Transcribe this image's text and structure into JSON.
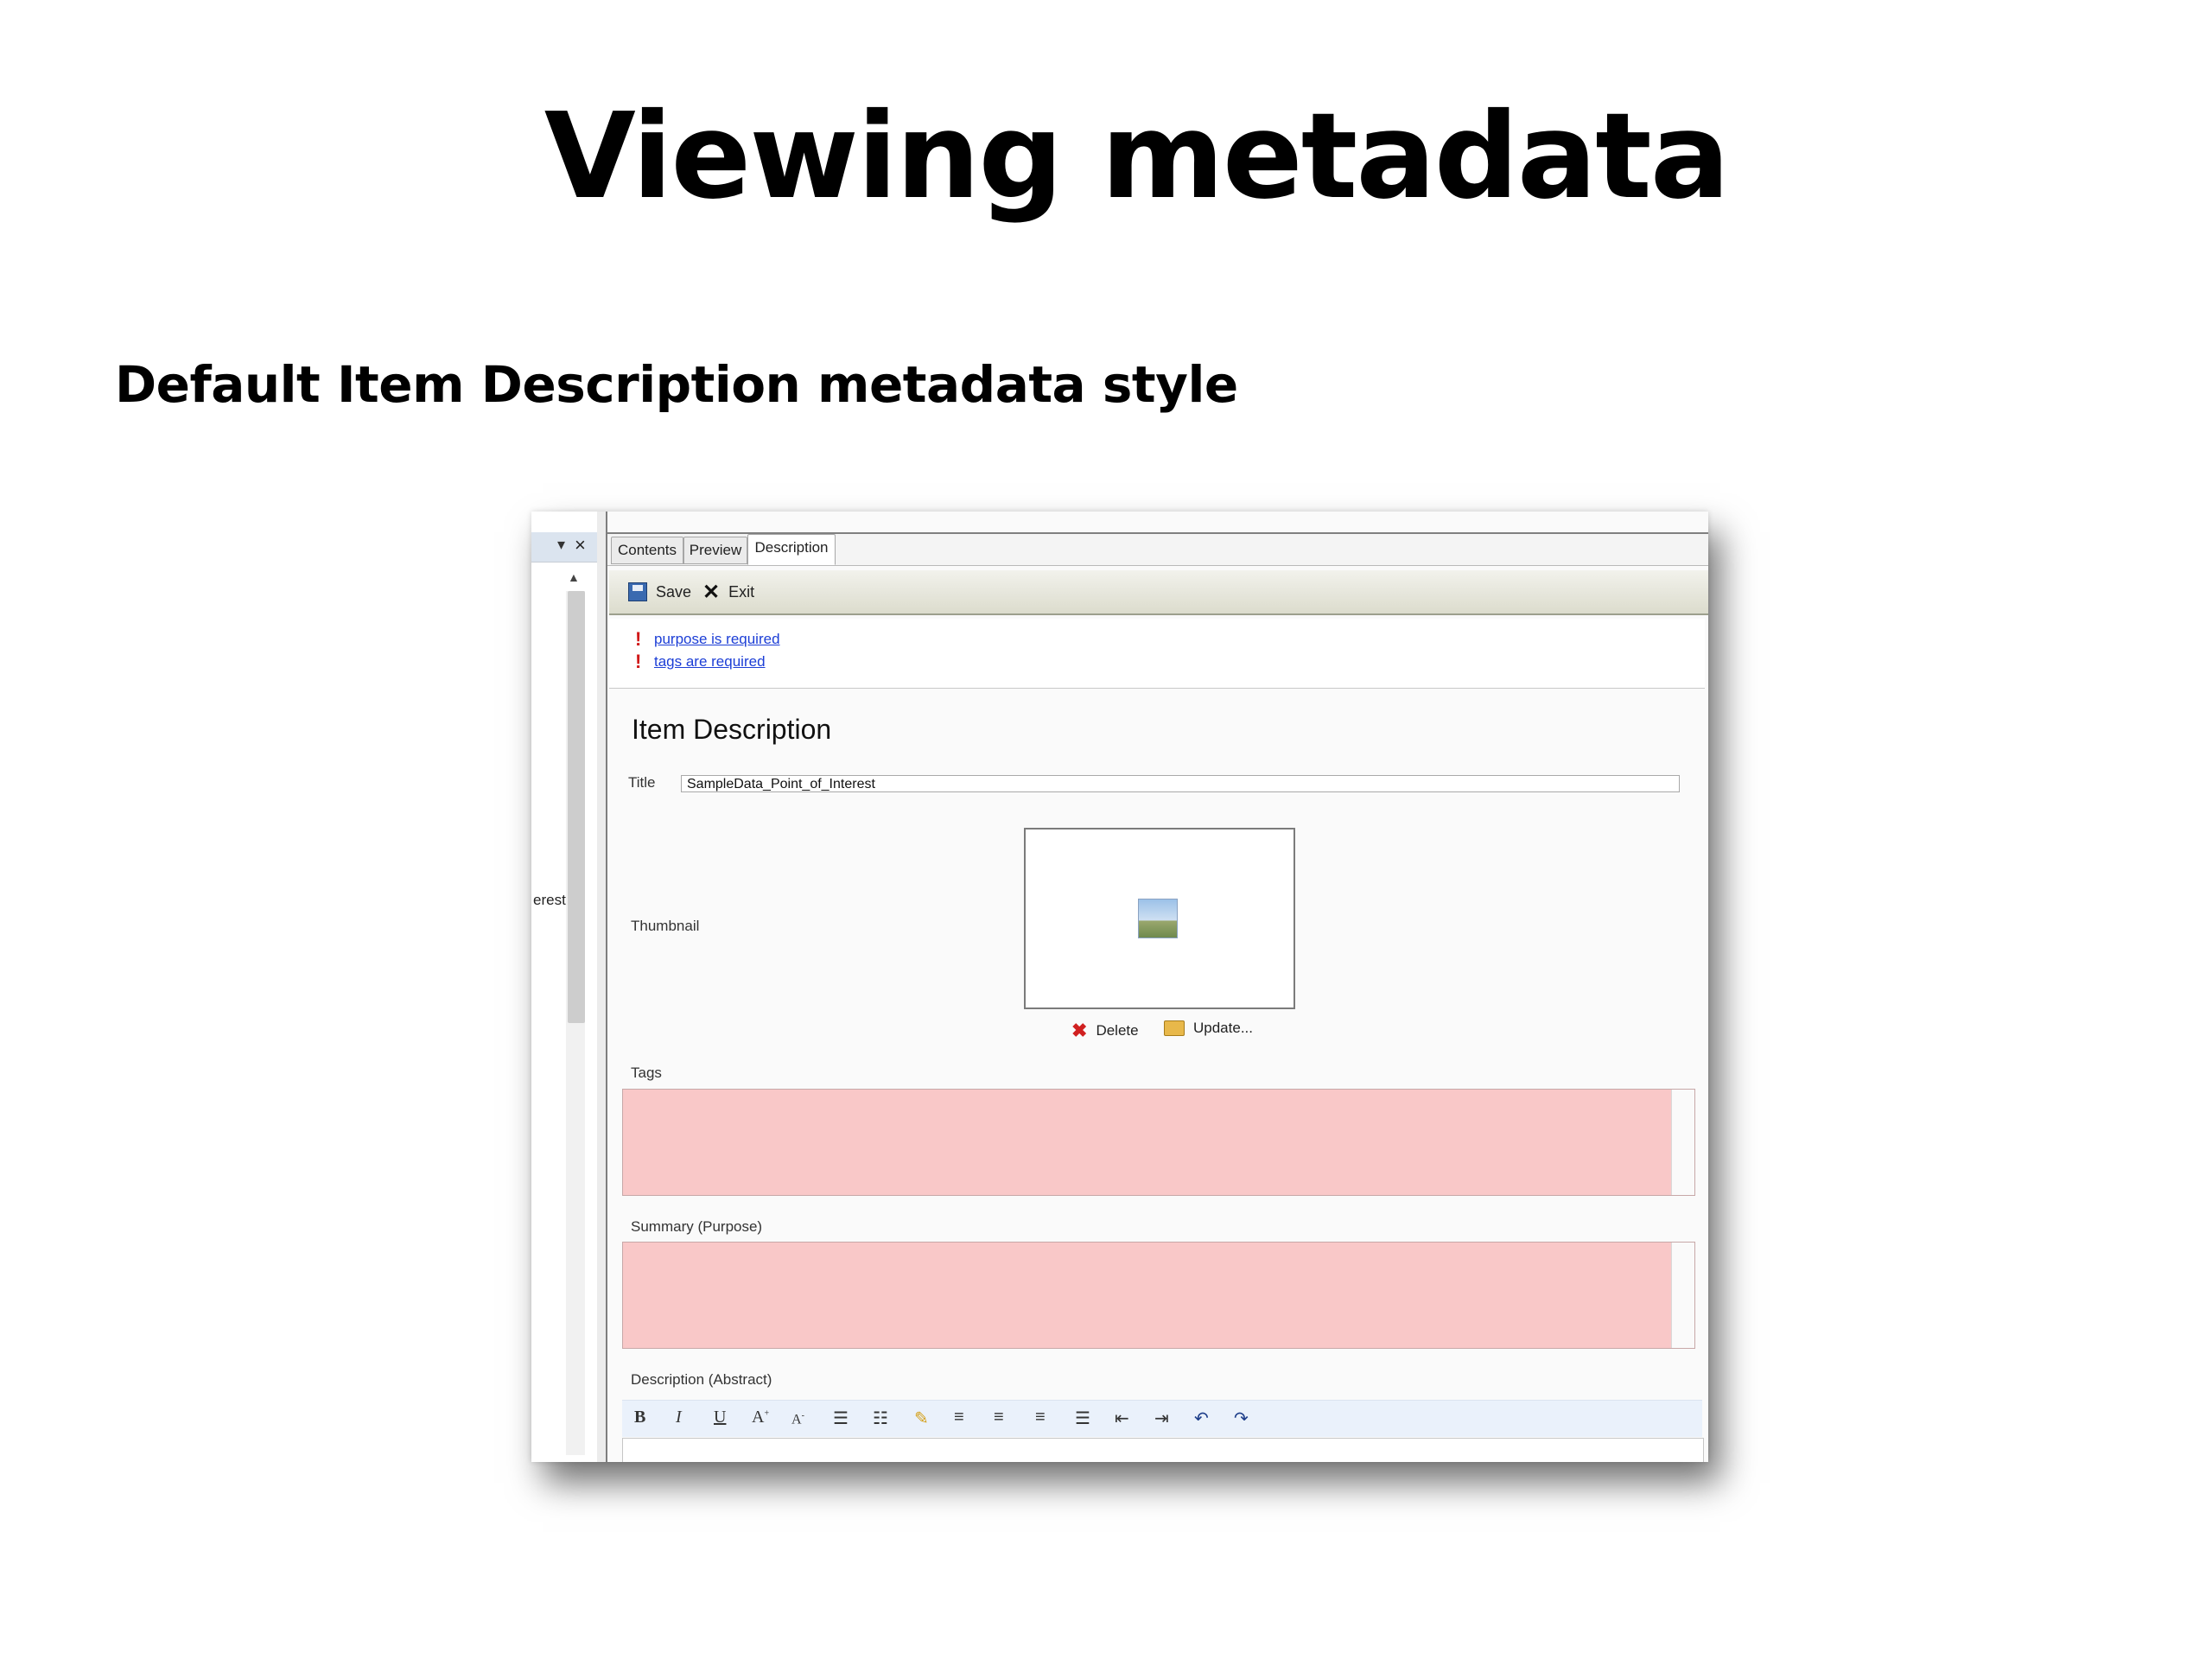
{
  "slide": {
    "title": "Viewing metadata",
    "subtitle": "Default Item Description metadata style"
  },
  "left_panel": {
    "pin_icon": "pin-icon",
    "close_icon": "close-icon",
    "partial_text": "erest"
  },
  "tabs": [
    {
      "label": "Contents",
      "active": false
    },
    {
      "label": "Preview",
      "active": false
    },
    {
      "label": "Description",
      "active": true
    }
  ],
  "toolbar": {
    "save_label": "Save",
    "exit_label": "Exit"
  },
  "errors": [
    {
      "icon": "exclamation",
      "text": "purpose is required"
    },
    {
      "icon": "exclamation",
      "text": "tags are required"
    }
  ],
  "form": {
    "heading": "Item Description",
    "title_label": "Title",
    "title_value": "SampleData_Point_of_Interest",
    "thumbnail_label": "Thumbnail",
    "thumbnail_delete": "Delete",
    "thumbnail_update": "Update...",
    "tags_label": "Tags",
    "summary_label": "Summary (Purpose)",
    "description_label": "Description (Abstract)",
    "required_field_color": "#f9c8c8"
  },
  "rich_text_toolbar": {
    "buttons": [
      "bold",
      "italic",
      "underline",
      "grow-font",
      "shrink-font",
      "bullet-list",
      "numbered-list",
      "highlight",
      "align-left",
      "align-center",
      "align-right",
      "justify",
      "outdent",
      "indent",
      "undo",
      "redo"
    ]
  }
}
